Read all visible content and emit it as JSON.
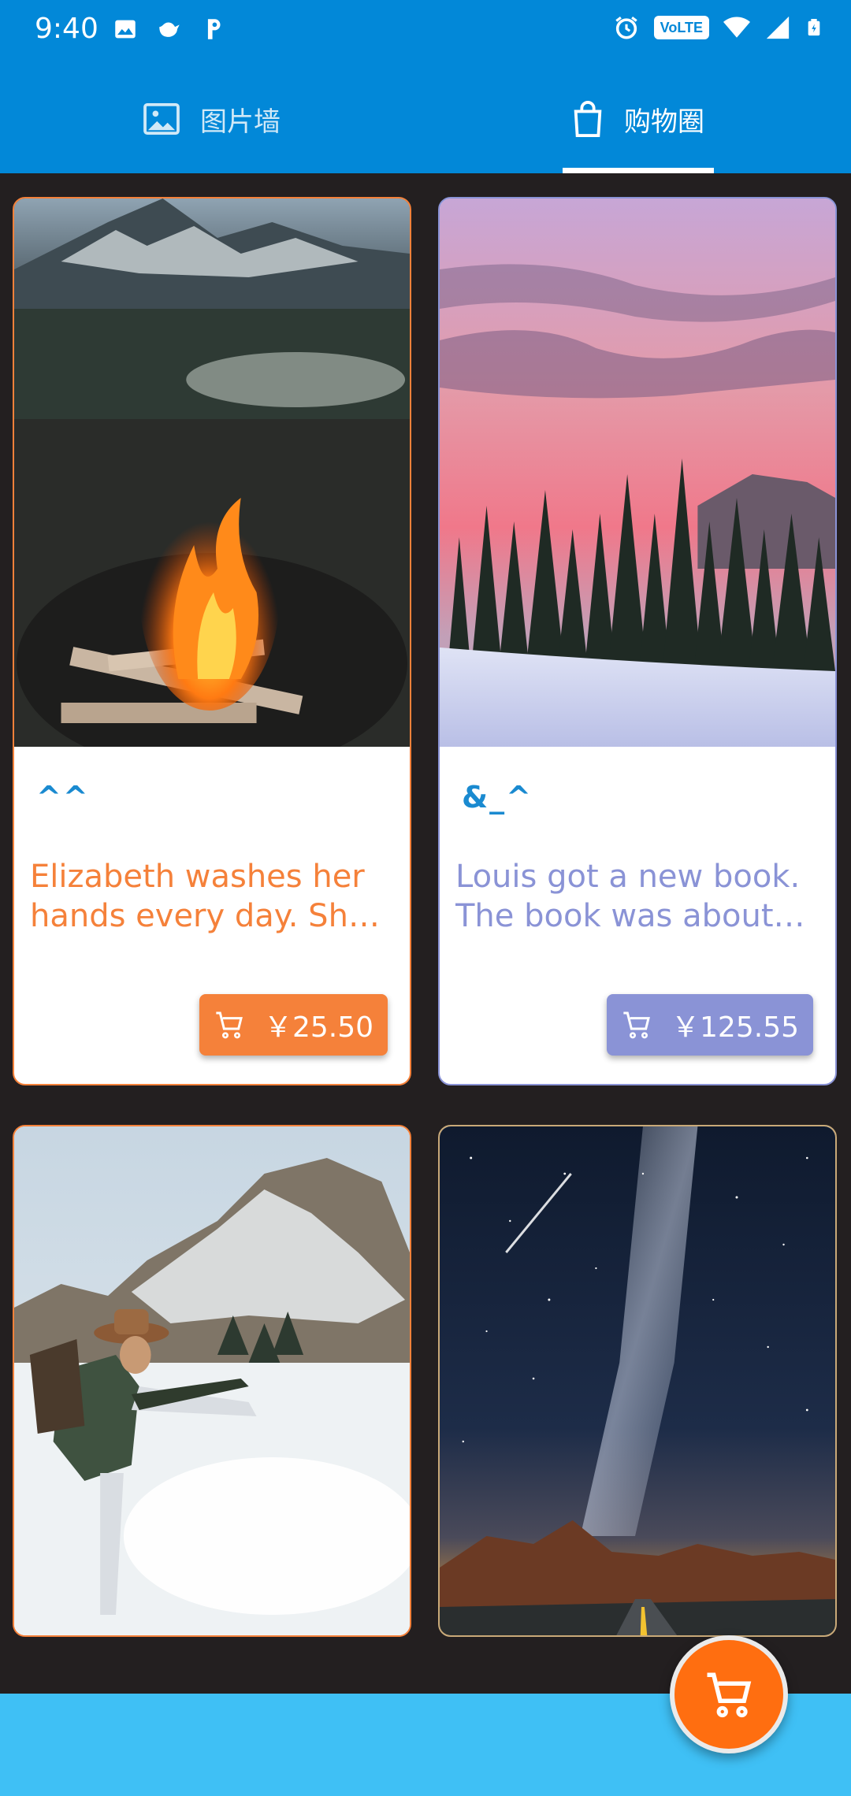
{
  "status_bar": {
    "time": "9:40",
    "volte": "VoLTE",
    "icons_left": [
      "image-icon",
      "bird-icon",
      "p-icon"
    ],
    "icons_right": [
      "alarm-icon",
      "volte-icon",
      "wifi-icon",
      "signal-icon",
      "battery-icon"
    ]
  },
  "tabs": [
    {
      "label": "图片墙",
      "icon": "image-icon",
      "active": false
    },
    {
      "label": "购物圈",
      "icon": "shopping-bag-icon",
      "active": true
    }
  ],
  "cards": [
    {
      "tag": "^^",
      "description": "Elizabeth washes her hands every day. She li…",
      "price": "￥25.50",
      "accent": "#f5813a",
      "image": "campfire-mountain-photo"
    },
    {
      "tag": "&_^",
      "description": "Louis got a new book. The book was about a…",
      "price": "￥125.55",
      "accent": "#8a93d6",
      "image": "pink-sky-forest-photo"
    },
    {
      "accent": "#f5813a",
      "image": "hiker-snow-mountain-photo"
    },
    {
      "accent": "#c9a978",
      "image": "milky-way-road-photo"
    }
  ],
  "colors": {
    "app_bar": "#0288d8",
    "background": "#231f20",
    "bottom_bar": "#3fc0f5",
    "fab": "#ff6e10",
    "tag_text": "#1a8ad0"
  },
  "fab": {
    "icon": "cart-icon"
  }
}
